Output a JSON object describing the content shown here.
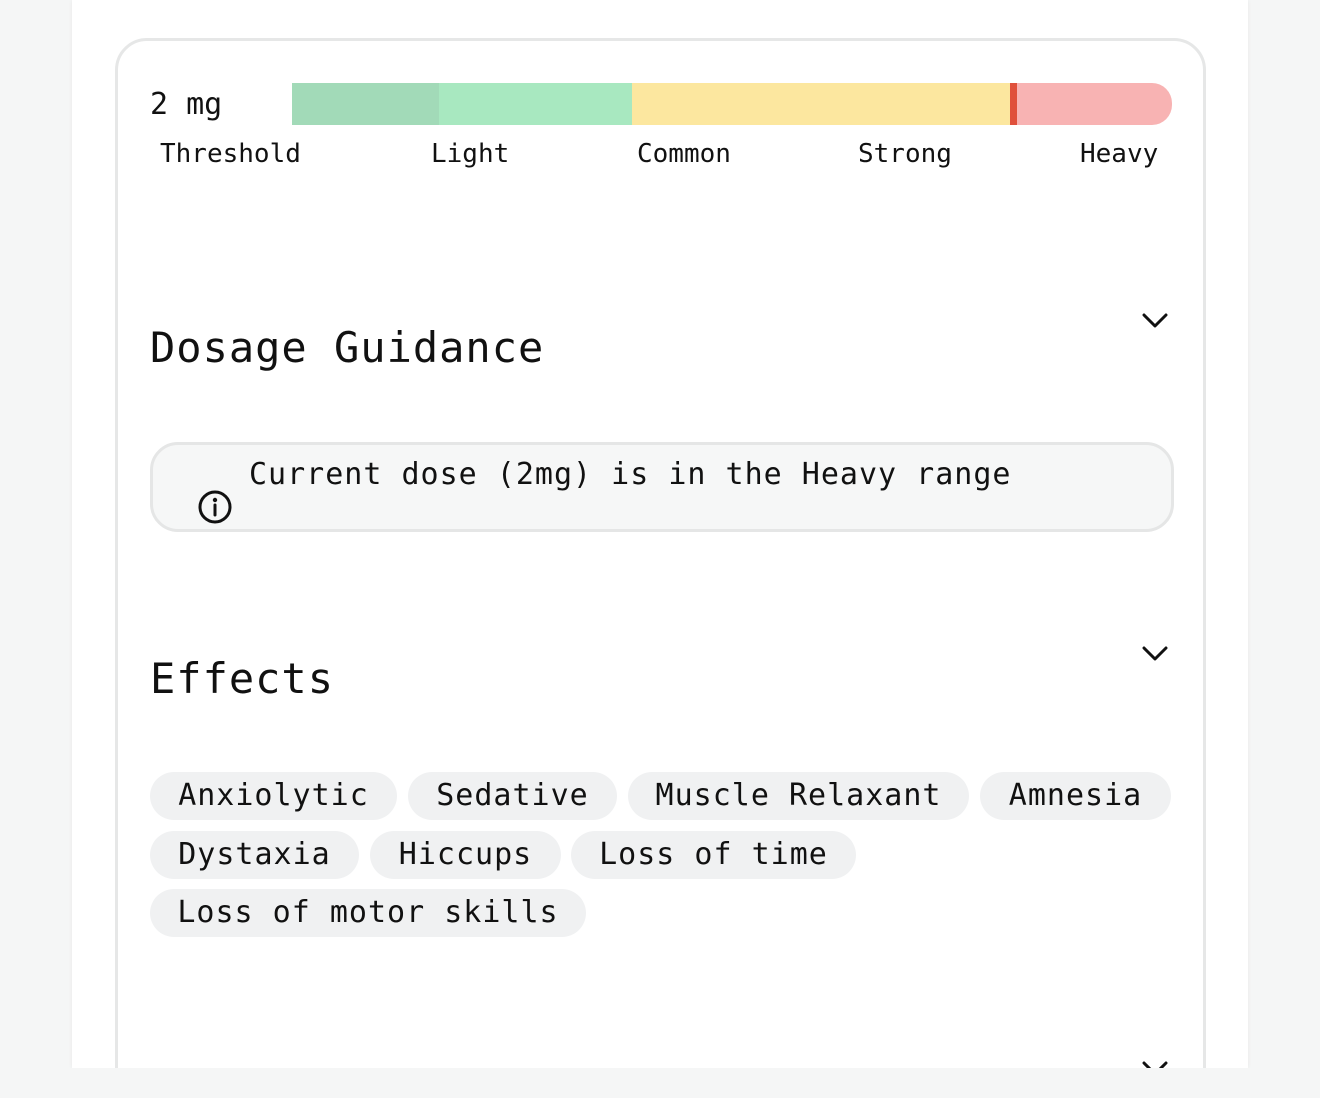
{
  "dose": {
    "value": "2 mg"
  },
  "range": {
    "labels": [
      "Threshold",
      "Light",
      "Common",
      "Strong",
      "Heavy"
    ],
    "colors": {
      "threshold": "#a2dab8",
      "light": "#a8e8c0",
      "common": "#fce79f",
      "heavy": "#f8b3b3",
      "marker": "#e0503b"
    }
  },
  "sections": {
    "dosage_guidance": {
      "title": "Dosage Guidance",
      "notice": "Current dose (2mg) is in the Heavy range"
    },
    "effects": {
      "title": "Effects",
      "tags": [
        "Anxiolytic",
        "Sedative",
        "Muscle Relaxant",
        "Amnesia",
        "Dystaxia",
        "Hiccups",
        "Loss of time",
        "Loss of motor skills"
      ]
    }
  }
}
